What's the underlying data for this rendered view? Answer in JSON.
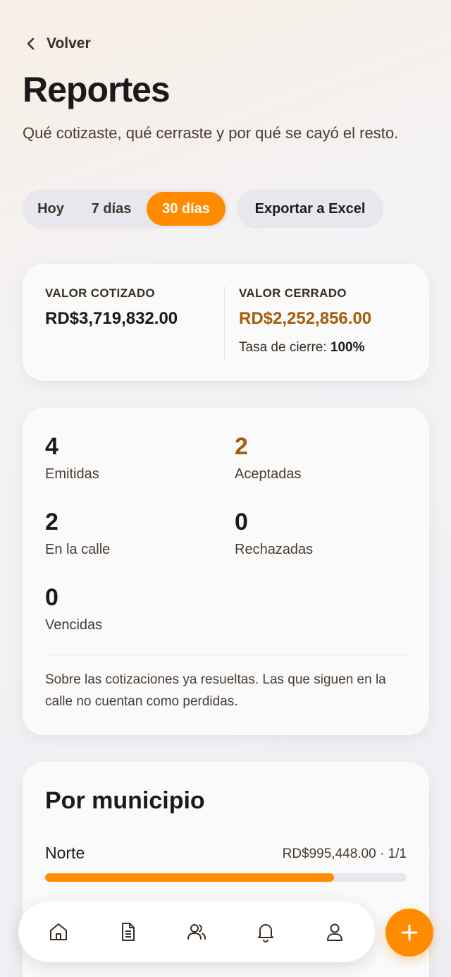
{
  "header": {
    "back_label": "Volver",
    "title": "Reportes",
    "subtitle": "Qué cotizaste, qué cerraste y por qué se cayó el resto."
  },
  "range_tabs": [
    {
      "label": "Hoy",
      "selected": false
    },
    {
      "label": "7 días",
      "selected": false
    },
    {
      "label": "30 días",
      "selected": true
    }
  ],
  "export_label": "Exportar a Excel",
  "summary": {
    "quoted_label": "VALOR COTIZADO",
    "quoted_value": "RD$3,719,832.00",
    "closed_label": "VALOR CERRADO",
    "closed_value": "RD$2,252,856.00",
    "rate_label": "Tasa de cierre:",
    "rate_value": "100%"
  },
  "stats": [
    {
      "value": "4",
      "label": "Emitidas"
    },
    {
      "value": "2",
      "label": "Aceptadas"
    },
    {
      "value": "2",
      "label": "En la calle"
    },
    {
      "value": "0",
      "label": "Rechazadas"
    },
    {
      "value": "0",
      "label": "Vencidas"
    }
  ],
  "stats_note": "Sobre las cotizaciones ya resueltas. Las que siguen en la calle no cuentan como perdidas.",
  "by_municipality": {
    "title": "Por municipio",
    "rows": [
      {
        "name": "Norte",
        "value": "RD$995,448.00 · 1/1",
        "share": 0.8
      }
    ]
  },
  "nav": {
    "items": [
      "home-icon",
      "document-icon",
      "users-icon",
      "bell-icon",
      "profile-icon"
    ]
  },
  "colors": {
    "accent": "#ff8c00",
    "accent_text": "#a55c0b"
  }
}
